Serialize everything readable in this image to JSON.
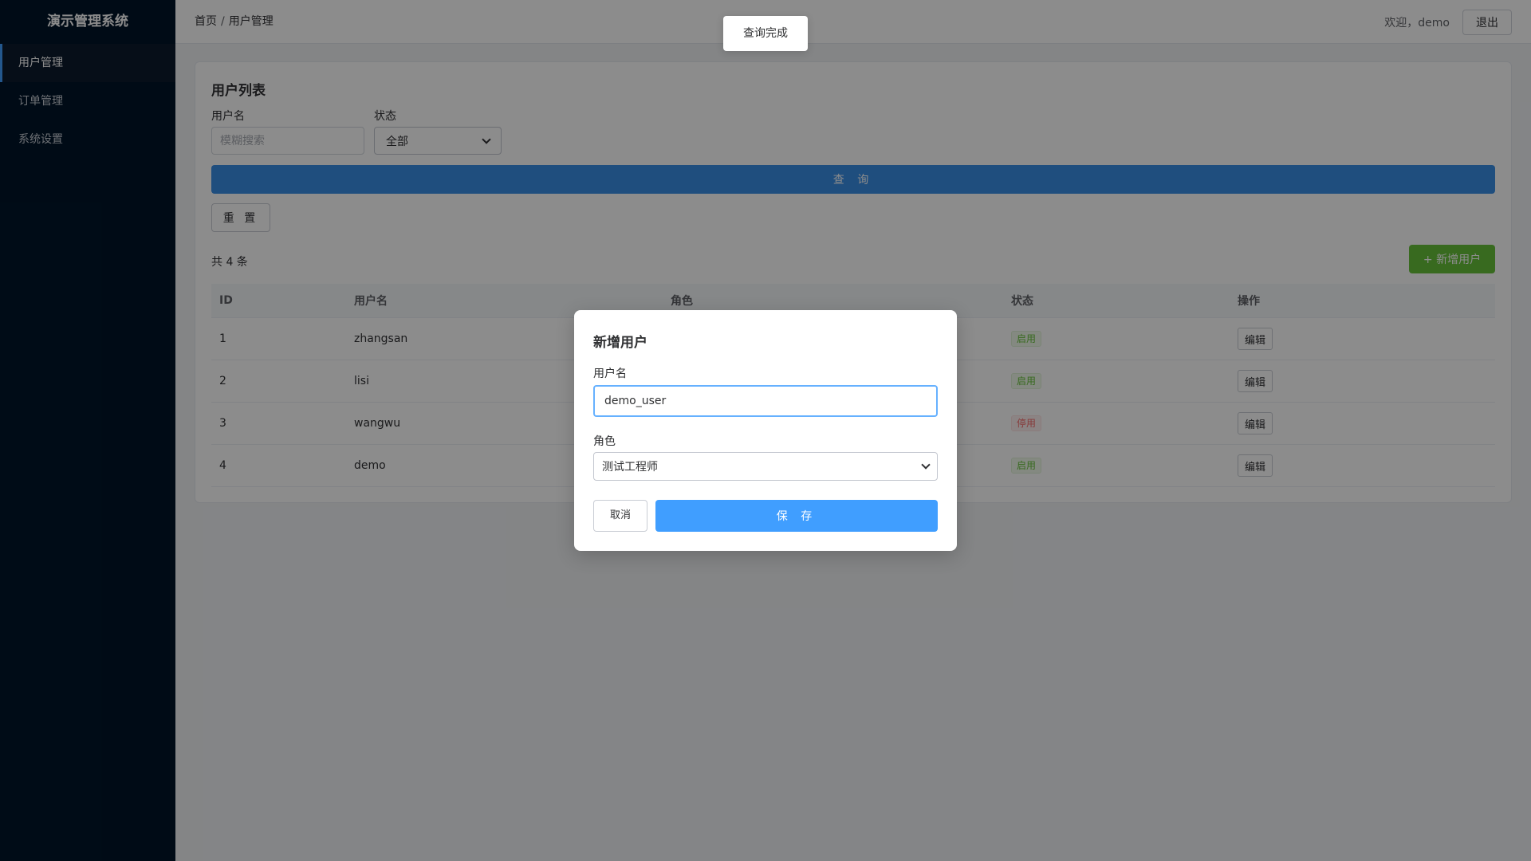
{
  "sidebar": {
    "brand": "演示管理系统",
    "items": [
      {
        "label": "用户管理",
        "active": true
      },
      {
        "label": "订单管理",
        "active": false
      },
      {
        "label": "系统设置",
        "active": false
      }
    ]
  },
  "header": {
    "breadcrumb": [
      "首页",
      "用户管理"
    ],
    "breadcrumb_sep": "/",
    "welcome": "欢迎，demo",
    "logout_label": "退出"
  },
  "toast": {
    "message": "查询完成"
  },
  "card": {
    "title": "用户列表",
    "filters": {
      "username_label": "用户名",
      "username_placeholder": "模糊搜索",
      "username_value": "",
      "status_label": "状态",
      "status_value": "全部"
    },
    "query_label": "查 询",
    "reset_label": "重 置",
    "total_text": "共 4 条",
    "add_label": "+ 新增用户"
  },
  "table": {
    "columns": [
      "ID",
      "用户名",
      "角色",
      "状态",
      "操作"
    ],
    "edit_label": "编辑",
    "rows": [
      {
        "id": "1",
        "username": "zhangsan",
        "role": "",
        "status": "启用",
        "enabled": true
      },
      {
        "id": "2",
        "username": "lisi",
        "role": "",
        "status": "启用",
        "enabled": true
      },
      {
        "id": "3",
        "username": "wangwu",
        "role": "",
        "status": "停用",
        "enabled": false
      },
      {
        "id": "4",
        "username": "demo",
        "role": "",
        "status": "启用",
        "enabled": true
      }
    ]
  },
  "modal": {
    "title": "新增用户",
    "username_label": "用户名",
    "username_value": "demo_user",
    "role_label": "角色",
    "role_value": "测试工程师",
    "cancel_label": "取消",
    "save_label": "保 存"
  },
  "colors": {
    "sidebar_bg": "#001529",
    "primary": "#409eff",
    "success": "#67c23a",
    "danger": "#f56c6c"
  }
}
